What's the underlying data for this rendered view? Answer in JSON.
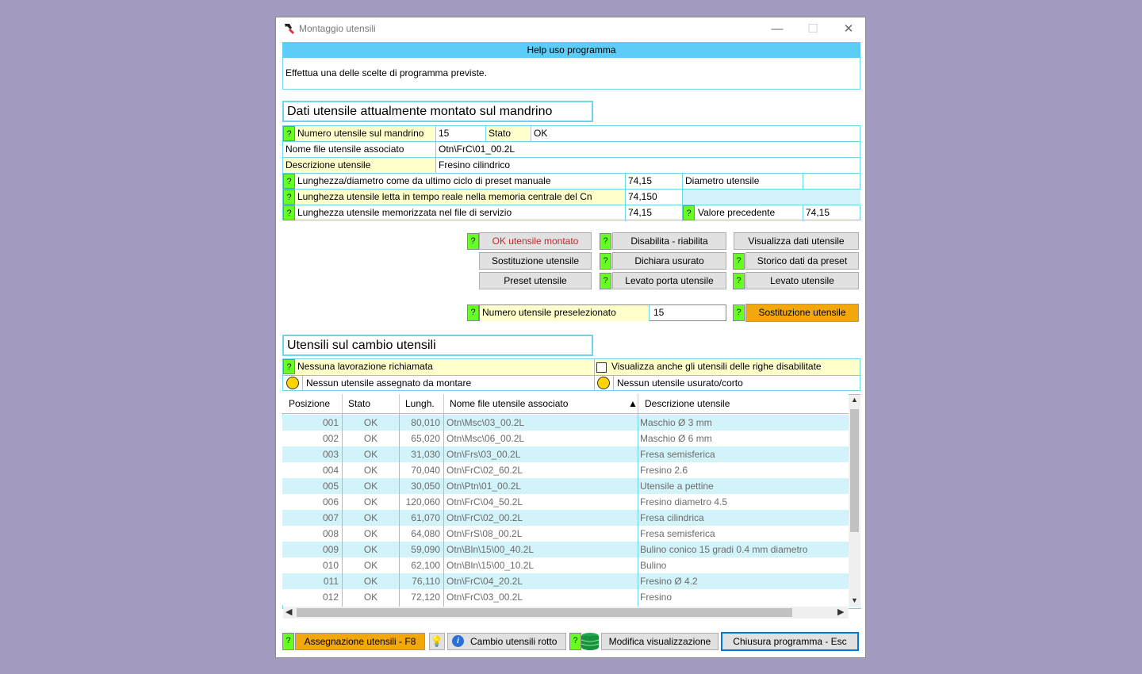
{
  "window": {
    "title": "Montaggio utensili"
  },
  "help": {
    "header": "Help uso programma",
    "text": "Effettua una delle scelte di programma previste."
  },
  "current_tool": {
    "section_title": "Dati utensile attualmente montato sul mandrino",
    "tool_number_label": "Numero utensile sul mandrino",
    "tool_number_value": "15",
    "state_label": "Stato",
    "state_value": "OK",
    "file_label": "Nome file utensile associato",
    "file_value": "Otn\\FrC\\01_00.2L",
    "desc_label": "Descrizione utensile",
    "desc_value": "Fresino cilindrico",
    "len_preset_label": "Lunghezza/diametro come da ultimo ciclo di preset manuale",
    "len_preset_value": "74,15",
    "diameter_label": "Diametro utensile",
    "diameter_value": "",
    "len_realtime_label": "Lunghezza utensile letta in tempo reale nella memoria centrale del Cn",
    "len_realtime_value": "74,150",
    "len_stored_label": "Lunghezza utensile memorizzata nel file di servizio",
    "len_stored_value": "74,15",
    "prev_value_label": "Valore precedente",
    "prev_value_value": "74,15"
  },
  "actions": {
    "ok_mounted": "OK utensile montato",
    "disable_enable": "Disabilita - riabilita",
    "view_data": "Visualizza dati utensile",
    "replace": "Sostituzione utensile",
    "declare_worn": "Dichiara usurato",
    "preset_history": "Storico dati da preset",
    "preset": "Preset utensile",
    "holder_removed": "Levato porta utensile",
    "tool_removed": "Levato utensile"
  },
  "preselect": {
    "label": "Numero utensile preselezionato",
    "value": "15",
    "button": "Sostituzione utensile"
  },
  "changer": {
    "section_title": "Utensili sul cambio utensili",
    "no_job": "Nessuna lavorazione richiamata",
    "show_disabled": "Visualizza anche gli utensili delle righe disabilitate",
    "no_assigned": "Nessun utensile assegnato da montare",
    "no_worn": "Nessun utensile usurato/corto"
  },
  "grid": {
    "columns": [
      "Posizione",
      "Stato",
      "Lungh.",
      "Nome file utensile associato",
      "Descrizione utensile"
    ],
    "rows": [
      [
        "001",
        "OK",
        "80,010",
        "Otn\\Msc\\03_00.2L",
        "Maschio Ø 3 mm"
      ],
      [
        "002",
        "OK",
        "65,020",
        "Otn\\Msc\\06_00.2L",
        "Maschio Ø 6 mm"
      ],
      [
        "003",
        "OK",
        "31,030",
        "Otn\\Frs\\03_00.2L",
        "Fresa semisferica"
      ],
      [
        "004",
        "OK",
        "70,040",
        "Otn\\FrC\\02_60.2L",
        "Fresino 2.6"
      ],
      [
        "005",
        "OK",
        "30,050",
        "Otn\\Ptn\\01_00.2L",
        "Utensile a pettine"
      ],
      [
        "006",
        "OK",
        "120,060",
        "Otn\\FrC\\04_50.2L",
        "Fresino diametro 4.5"
      ],
      [
        "007",
        "OK",
        "61,070",
        "Otn\\FrC\\02_00.2L",
        "Fresa cilindrica"
      ],
      [
        "008",
        "OK",
        "64,080",
        "Otn\\FrS\\08_00.2L",
        "Fresa semisferica"
      ],
      [
        "009",
        "OK",
        "59,090",
        "Otn\\Bln\\15\\00_40.2L",
        "Bulino conico 15 gradi 0.4 mm diametro"
      ],
      [
        "010",
        "OK",
        "62,100",
        "Otn\\Bln\\15\\00_10.2L",
        "Bulino"
      ],
      [
        "011",
        "OK",
        "76,110",
        "Otn\\FrC\\04_20.2L",
        "Fresino Ø 4.2"
      ],
      [
        "012",
        "OK",
        "72,120",
        "Otn\\FrC\\03_00.2L",
        "Fresino"
      ]
    ]
  },
  "footer": {
    "assign": "Assegnazione utensili - F8",
    "broken": "Cambio utensili rotto",
    "modify_view": "Modifica visualizzazione",
    "close": "Chiusura programma - Esc"
  },
  "colors": {
    "cyan": "#5dcdf7",
    "light_cyan": "#d3f3fa",
    "yellow": "#ffffcc",
    "green": "#66ff22",
    "orange": "#f2a70c"
  },
  "q": "?"
}
